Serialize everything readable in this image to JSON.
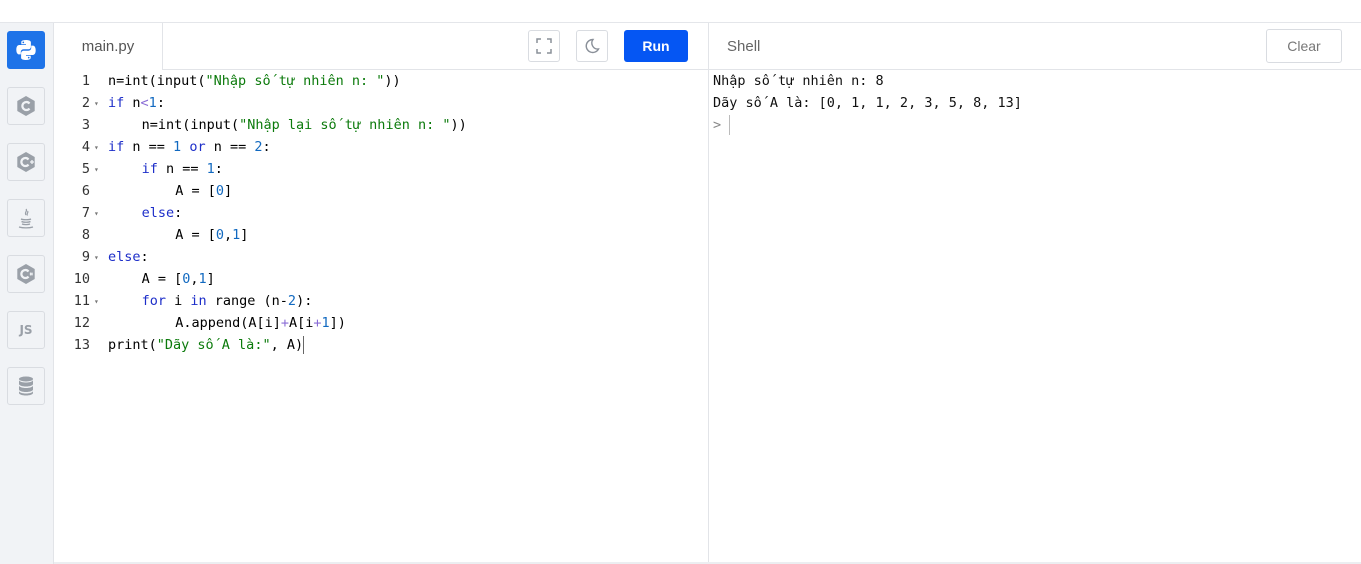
{
  "editor": {
    "filename": "main.py",
    "run_label": "Run",
    "lines": [
      {
        "n": "1",
        "fold": "",
        "indent": 0,
        "tokens": [
          [
            "",
            "n=int(input("
          ],
          [
            "str",
            "\"Nhập số tự nhiên n: \""
          ],
          [
            "",
            "))"
          ]
        ]
      },
      {
        "n": "2",
        "fold": "▾",
        "indent": 0,
        "tokens": [
          [
            "kw",
            "if"
          ],
          [
            "",
            " n"
          ],
          [
            "op",
            "<"
          ],
          [
            "num",
            "1"
          ],
          [
            "",
            ":"
          ]
        ]
      },
      {
        "n": "3",
        "fold": "",
        "indent": 1,
        "tokens": [
          [
            "",
            "n=int(input("
          ],
          [
            "str",
            "\"Nhập lại số tự nhiên n: \""
          ],
          [
            "",
            "))"
          ]
        ]
      },
      {
        "n": "4",
        "fold": "▾",
        "indent": 0,
        "tokens": [
          [
            "kw",
            "if"
          ],
          [
            "",
            " n == "
          ],
          [
            "num",
            "1"
          ],
          [
            "",
            " "
          ],
          [
            "kw",
            "or"
          ],
          [
            "",
            " n == "
          ],
          [
            "num",
            "2"
          ],
          [
            "",
            ":"
          ]
        ]
      },
      {
        "n": "5",
        "fold": "▾",
        "indent": 1,
        "tokens": [
          [
            "kw",
            "if"
          ],
          [
            "",
            " n == "
          ],
          [
            "num",
            "1"
          ],
          [
            "",
            ":"
          ]
        ]
      },
      {
        "n": "6",
        "fold": "",
        "indent": 2,
        "tokens": [
          [
            "",
            "A = ["
          ],
          [
            "num",
            "0"
          ],
          [
            "",
            "]"
          ]
        ]
      },
      {
        "n": "7",
        "fold": "▾",
        "indent": 1,
        "tokens": [
          [
            "kw",
            "else"
          ],
          [
            "",
            ":"
          ]
        ]
      },
      {
        "n": "8",
        "fold": "",
        "indent": 2,
        "tokens": [
          [
            "",
            "A = ["
          ],
          [
            "num",
            "0"
          ],
          [
            "",
            ","
          ],
          [
            "num",
            "1"
          ],
          [
            "",
            "]"
          ]
        ]
      },
      {
        "n": "9",
        "fold": "▾",
        "indent": 0,
        "tokens": [
          [
            "kw",
            "else"
          ],
          [
            "",
            ":"
          ]
        ]
      },
      {
        "n": "10",
        "fold": "",
        "indent": 1,
        "tokens": [
          [
            "",
            "A = ["
          ],
          [
            "num",
            "0"
          ],
          [
            "",
            ","
          ],
          [
            "num",
            "1"
          ],
          [
            "",
            "]"
          ]
        ]
      },
      {
        "n": "11",
        "fold": "▾",
        "indent": 1,
        "tokens": [
          [
            "kw",
            "for"
          ],
          [
            "",
            " i "
          ],
          [
            "kw",
            "in"
          ],
          [
            "",
            " range (n-"
          ],
          [
            "num",
            "2"
          ],
          [
            "",
            "):"
          ]
        ]
      },
      {
        "n": "12",
        "fold": "",
        "indent": 2,
        "tokens": [
          [
            "",
            "A.append(A[i]"
          ],
          [
            "op",
            "+"
          ],
          [
            "",
            "A[i"
          ],
          [
            "op",
            "+"
          ],
          [
            "num",
            "1"
          ],
          [
            "",
            "])"
          ]
        ]
      },
      {
        "n": "13",
        "fold": "",
        "indent": 0,
        "tokens": [
          [
            "",
            "print("
          ],
          [
            "str",
            "\"Dãy số A là:\""
          ],
          [
            "",
            ", A)"
          ]
        ]
      }
    ]
  },
  "shell": {
    "title": "Shell",
    "clear_label": "Clear",
    "output": [
      "Nhập số tự nhiên n: 8",
      "Dãy số A là: [0, 1, 1, 2, 3, 5, 8, 13]"
    ],
    "prompt": ">"
  },
  "sidebar": {
    "items": [
      {
        "name": "python-icon",
        "active": true
      },
      {
        "name": "c-icon",
        "active": false
      },
      {
        "name": "cpp-icon",
        "active": false
      },
      {
        "name": "java-icon",
        "active": false
      },
      {
        "name": "csharp-icon",
        "active": false
      },
      {
        "name": "js-icon",
        "active": false,
        "label": "JS"
      },
      {
        "name": "database-icon",
        "active": false
      }
    ]
  },
  "colors": {
    "accent": "#0556f3",
    "active_lang": "#1e73e8",
    "keyword": "#1d2ec9",
    "string": "#0b7a0b",
    "number": "#1169c0"
  }
}
